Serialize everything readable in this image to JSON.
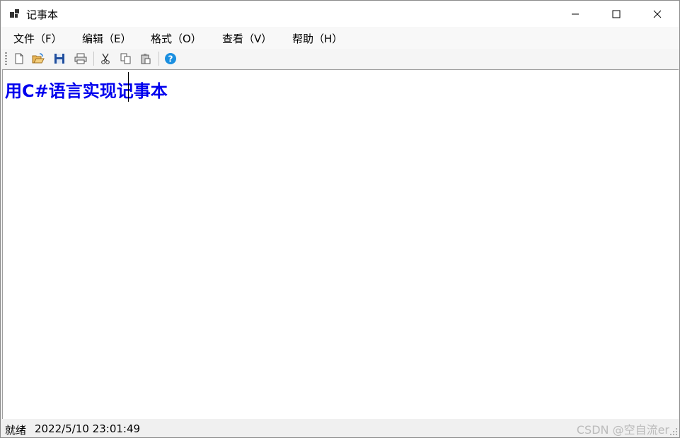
{
  "window": {
    "title": "记事本"
  },
  "menu": [
    {
      "id": "file",
      "label": "文件（F）"
    },
    {
      "id": "edit",
      "label": "编辑（E）"
    },
    {
      "id": "format",
      "label": "格式（O）"
    },
    {
      "id": "view",
      "label": "查看（V）"
    },
    {
      "id": "help",
      "label": "帮助（H）"
    }
  ],
  "toolbar": {
    "icons": [
      "new-file-icon",
      "open-folder-icon",
      "save-icon",
      "print-icon",
      "cut-icon",
      "copy-icon",
      "paste-icon",
      "help-icon"
    ]
  },
  "editor": {
    "text": "用C#语言实现记事本",
    "text_color": "#0000ee"
  },
  "status": {
    "state": "就绪",
    "datetime": "2022/5/10 23:01:49"
  },
  "watermark": "CSDN @空自流er"
}
